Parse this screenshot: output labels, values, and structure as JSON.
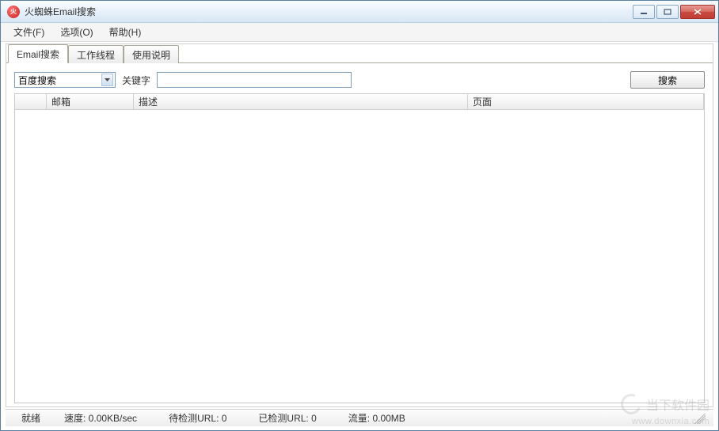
{
  "window": {
    "title": "火蜘蛛Email搜索"
  },
  "menu": {
    "file": "文件(F)",
    "options": "选项(O)",
    "help": "帮助(H)"
  },
  "tabs": {
    "search": "Email搜索",
    "threads": "工作线程",
    "instructions": "使用说明"
  },
  "search": {
    "engine_selected": "百度搜索",
    "keyword_label": "关键字",
    "keyword_value": "",
    "search_button": "搜索"
  },
  "table": {
    "columns": {
      "c0": "",
      "c1": "邮箱",
      "c2": "描述",
      "c3": "页面"
    },
    "rows": []
  },
  "status": {
    "ready": "就绪",
    "speed": "速度: 0.00KB/sec",
    "pending": "待检测URL: 0",
    "checked": "已检测URL: 0",
    "traffic": "流量: 0.00MB"
  },
  "watermark": {
    "text": "当下软件园",
    "url": "www.downxia.com"
  }
}
